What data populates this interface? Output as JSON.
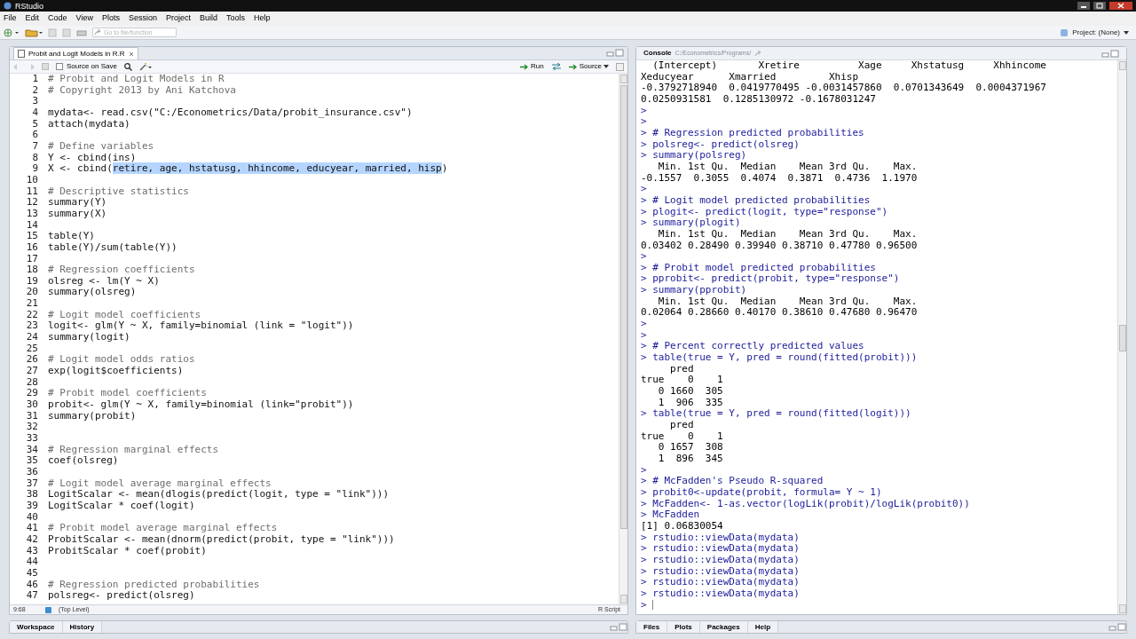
{
  "window": {
    "title": "RStudio"
  },
  "menu": [
    "File",
    "Edit",
    "Code",
    "View",
    "Plots",
    "Session",
    "Project",
    "Build",
    "Tools",
    "Help"
  ],
  "toolbar": {
    "goto_placeholder": "Go to file/function",
    "project": "Project: (None)"
  },
  "editor": {
    "tabs": [
      {
        "label": "Probit and Logit Models in R.R",
        "selected": true
      }
    ],
    "source_on_save": {
      "label": "Source on Save",
      "checked": false
    },
    "run_label": "Run",
    "source_label": "Source",
    "lines": [
      {
        "n": "1",
        "kind": "comment",
        "text": "# Probit and Logit Models in R"
      },
      {
        "n": "2",
        "kind": "comment",
        "text": "# Copyright 2013 by Ani Katchova"
      },
      {
        "n": "3",
        "kind": "code"
      },
      {
        "n": "4",
        "kind": "code",
        "text": "mydata<- read.csv(\"C:/Econometrics/Data/probit_insurance.csv\")"
      },
      {
        "n": "5",
        "kind": "code",
        "text": "attach(mydata)"
      },
      {
        "n": "6",
        "kind": "code"
      },
      {
        "n": "7",
        "kind": "comment",
        "text": "# Define variables"
      },
      {
        "n": "8",
        "kind": "code",
        "text": "Y <- cbind(ins)"
      },
      {
        "n": "9",
        "kind": "code",
        "segments": [
          {
            "text": "X <- cbind(",
            "selected": false
          },
          {
            "text": "retire, age, hstatusg, hhincome, educyear, married, hisp",
            "selected": true
          },
          {
            "text": ")",
            "selected": false
          }
        ]
      },
      {
        "n": "10",
        "kind": "code"
      },
      {
        "n": "11",
        "kind": "comment",
        "text": "# Descriptive statistics"
      },
      {
        "n": "12",
        "kind": "code",
        "text": "summary(Y)"
      },
      {
        "n": "13",
        "kind": "code",
        "text": "summary(X)"
      },
      {
        "n": "14",
        "kind": "code"
      },
      {
        "n": "15",
        "kind": "code",
        "text": "table(Y)"
      },
      {
        "n": "16",
        "kind": "code",
        "text": "table(Y)/sum(table(Y))"
      },
      {
        "n": "17",
        "kind": "code"
      },
      {
        "n": "18",
        "kind": "comment",
        "text": "# Regression coefficients"
      },
      {
        "n": "19",
        "kind": "code",
        "text": "olsreg <- lm(Y ~ X)"
      },
      {
        "n": "20",
        "kind": "code",
        "text": "summary(olsreg)"
      },
      {
        "n": "21",
        "kind": "code"
      },
      {
        "n": "22",
        "kind": "comment",
        "text": "# Logit model coefficients"
      },
      {
        "n": "23",
        "kind": "code",
        "text": "logit<- glm(Y ~ X, family=binomial (link = \"logit\"))"
      },
      {
        "n": "24",
        "kind": "code",
        "text": "summary(logit)"
      },
      {
        "n": "25",
        "kind": "code"
      },
      {
        "n": "26",
        "kind": "comment",
        "text": "# Logit model odds ratios"
      },
      {
        "n": "27",
        "kind": "code",
        "text": "exp(logit$coefficients)"
      },
      {
        "n": "28",
        "kind": "code"
      },
      {
        "n": "29",
        "kind": "comment",
        "text": "# Probit model coefficients"
      },
      {
        "n": "30",
        "kind": "code",
        "text": "probit<- glm(Y ~ X, family=binomial (link=\"probit\"))"
      },
      {
        "n": "31",
        "kind": "code",
        "text": "summary(probit)"
      },
      {
        "n": "32",
        "kind": "code"
      },
      {
        "n": "33",
        "kind": "code"
      },
      {
        "n": "34",
        "kind": "comment",
        "text": "# Regression marginal effects"
      },
      {
        "n": "35",
        "kind": "code",
        "text": "coef(olsreg)"
      },
      {
        "n": "36",
        "kind": "code"
      },
      {
        "n": "37",
        "kind": "comment",
        "text": "# Logit model average marginal effects"
      },
      {
        "n": "38",
        "kind": "code",
        "text": "LogitScalar <- mean(dlogis(predict(logit, type = \"link\")))"
      },
      {
        "n": "39",
        "kind": "code",
        "text": "LogitScalar * coef(logit)"
      },
      {
        "n": "40",
        "kind": "code"
      },
      {
        "n": "41",
        "kind": "comment",
        "text": "# Probit model average marginal effects"
      },
      {
        "n": "42",
        "kind": "code",
        "text": "ProbitScalar <- mean(dnorm(predict(probit, type = \"link\")))"
      },
      {
        "n": "43",
        "kind": "code",
        "text": "ProbitScalar * coef(probit)"
      },
      {
        "n": "44",
        "kind": "code"
      },
      {
        "n": "45",
        "kind": "code"
      },
      {
        "n": "46",
        "kind": "comment",
        "text": "# Regression predicted probabilities"
      },
      {
        "n": "47",
        "kind": "code",
        "text": "polsreg<- predict(olsreg)"
      }
    ],
    "status": {
      "position": "9:68",
      "scope": "(Top Level)",
      "file_type": "R Script"
    }
  },
  "console": {
    "title": "Console",
    "path": "C:/Econometrics/Programs/",
    "lines": [
      {
        "kind": "output",
        "text": "  (Intercept)       Xretire          Xage     Xhstatusg     Xhhincome"
      },
      {
        "kind": "output",
        "text": "Xeducyear      Xmarried         Xhisp"
      },
      {
        "kind": "output",
        "text": "-0.3792718940  0.0419770495 -0.0031457860  0.0701343649  0.0004371967"
      },
      {
        "kind": "output",
        "text": "0.0250931581  0.1285130972 -0.1678031247"
      },
      {
        "kind": "input",
        "text": ">"
      },
      {
        "kind": "input",
        "text": ">"
      },
      {
        "kind": "input",
        "text": "> # Regression predicted probabilities"
      },
      {
        "kind": "input",
        "text": "> polsreg<- predict(olsreg)"
      },
      {
        "kind": "input",
        "text": "> summary(polsreg)"
      },
      {
        "kind": "output",
        "text": "   Min. 1st Qu.  Median    Mean 3rd Qu.    Max."
      },
      {
        "kind": "output",
        "text": "-0.1557  0.3055  0.4074  0.3871  0.4736  1.1970"
      },
      {
        "kind": "input",
        "text": ">"
      },
      {
        "kind": "input",
        "text": "> # Logit model predicted probabilities"
      },
      {
        "kind": "input",
        "text": "> plogit<- predict(logit, type=\"response\")"
      },
      {
        "kind": "input",
        "text": "> summary(plogit)"
      },
      {
        "kind": "output",
        "text": "   Min. 1st Qu.  Median    Mean 3rd Qu.    Max."
      },
      {
        "kind": "output",
        "text": "0.03402 0.28490 0.39940 0.38710 0.47780 0.96500"
      },
      {
        "kind": "input",
        "text": ">"
      },
      {
        "kind": "input",
        "text": "> # Probit model predicted probabilities"
      },
      {
        "kind": "input",
        "text": "> pprobit<- predict(probit, type=\"response\")"
      },
      {
        "kind": "input",
        "text": "> summary(pprobit)"
      },
      {
        "kind": "output",
        "text": "   Min. 1st Qu.  Median    Mean 3rd Qu.    Max."
      },
      {
        "kind": "output",
        "text": "0.02064 0.28660 0.40170 0.38610 0.47680 0.96470"
      },
      {
        "kind": "input",
        "text": ">"
      },
      {
        "kind": "input",
        "text": ">"
      },
      {
        "kind": "input",
        "text": "> # Percent correctly predicted values"
      },
      {
        "kind": "input",
        "text": "> table(true = Y, pred = round(fitted(probit)))"
      },
      {
        "kind": "output",
        "text": "     pred"
      },
      {
        "kind": "output",
        "text": "true    0    1"
      },
      {
        "kind": "output",
        "text": "   0 1660  305"
      },
      {
        "kind": "output",
        "text": "   1  906  335"
      },
      {
        "kind": "input",
        "text": "> table(true = Y, pred = round(fitted(logit)))"
      },
      {
        "kind": "output",
        "text": "     pred"
      },
      {
        "kind": "output",
        "text": "true    0    1"
      },
      {
        "kind": "output",
        "text": "   0 1657  308"
      },
      {
        "kind": "output",
        "text": "   1  896  345"
      },
      {
        "kind": "input",
        "text": ">"
      },
      {
        "kind": "input",
        "text": "> # McFadden's Pseudo R-squared"
      },
      {
        "kind": "input",
        "text": "> probit0<-update(probit, formula= Y ~ 1)"
      },
      {
        "kind": "input",
        "text": "> McFadden<- 1-as.vector(logLik(probit)/logLik(probit0))"
      },
      {
        "kind": "input",
        "text": "> McFadden"
      },
      {
        "kind": "output",
        "text": "[1] 0.06830054"
      },
      {
        "kind": "input",
        "text": "> rstudio::viewData(mydata)"
      },
      {
        "kind": "input",
        "text": "> rstudio::viewData(mydata)"
      },
      {
        "kind": "input",
        "text": "> rstudio::viewData(mydata)"
      },
      {
        "kind": "input",
        "text": "> rstudio::viewData(mydata)"
      },
      {
        "kind": "input",
        "text": "> rstudio::viewData(mydata)"
      },
      {
        "kind": "input",
        "text": "> rstudio::viewData(mydata)"
      },
      {
        "kind": "prompt",
        "text": ">"
      }
    ]
  },
  "bottom_left_tabs": [
    {
      "label": "Workspace",
      "selected": false
    },
    {
      "label": "History",
      "selected": false
    }
  ],
  "bottom_right_tabs": [
    {
      "label": "Files",
      "selected": false
    },
    {
      "label": "Plots",
      "selected": false
    },
    {
      "label": "Packages",
      "selected": false
    },
    {
      "label": "Help",
      "selected": false
    }
  ]
}
